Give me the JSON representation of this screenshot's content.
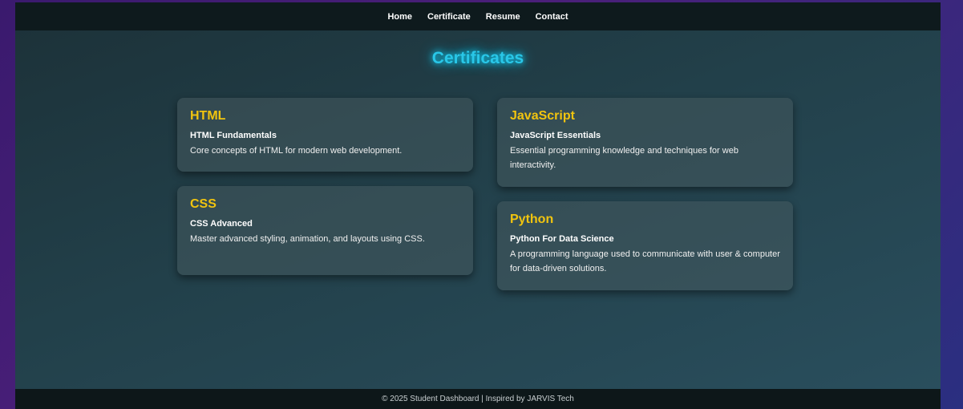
{
  "nav": {
    "items": [
      "Home",
      "Certificate",
      "Resume",
      "Contact"
    ]
  },
  "page": {
    "title": "Certificates"
  },
  "certificates": [
    {
      "title": "HTML",
      "subtitle": "HTML Fundamentals",
      "description": "Core concepts of HTML for modern web development."
    },
    {
      "title": "JavaScript",
      "subtitle": "JavaScript Essentials",
      "description": "Essential programming knowledge and techniques for web interactivity."
    },
    {
      "title": "CSS",
      "subtitle": "CSS Advanced",
      "description": "Master advanced styling, animation, and layouts using CSS."
    },
    {
      "title": "Python",
      "subtitle": "Python For Data Science",
      "description": "A programming language used to communicate with user & computer for data-driven solutions."
    }
  ],
  "footer": {
    "text": "© 2025 Student Dashboard | Inspired by JARVIS Tech"
  },
  "colors": {
    "accent_title": "#29c7e8",
    "card_title": "#f1c40f",
    "navbar_bg": "#0e1a1d"
  }
}
